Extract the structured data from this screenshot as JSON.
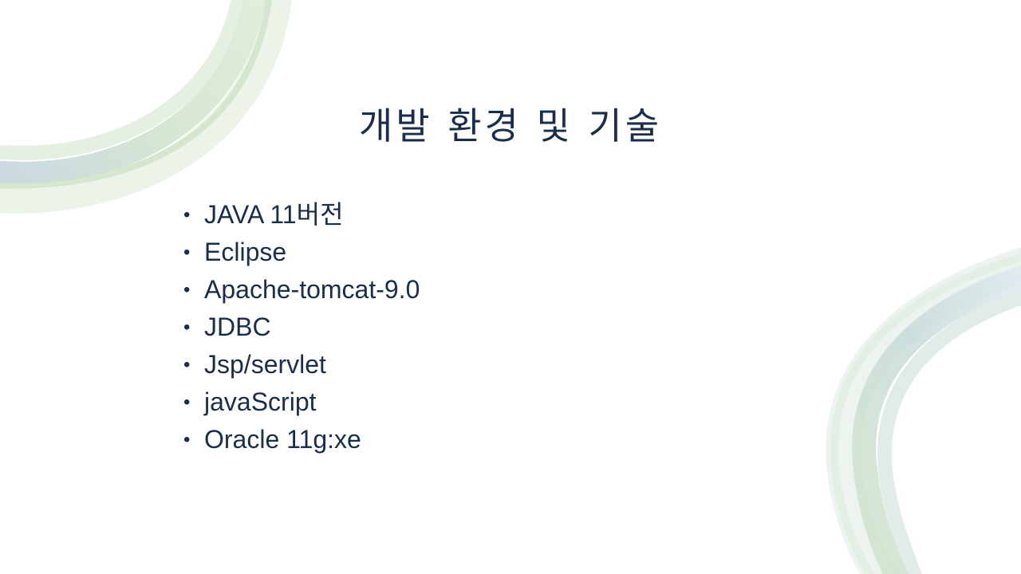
{
  "slide": {
    "title": "개발 환경 및 기술",
    "bullet_glyph": "•",
    "items": [
      "JAVA 11버전",
      "Eclipse",
      "Apache-tomcat-9.0",
      "JDBC",
      "Jsp/servlet",
      "javaScript",
      "Oracle 11g:xe"
    ]
  },
  "colors": {
    "text": "#1a2e4a",
    "accent_green": "#bcd9b0",
    "accent_blue": "#b9d0dc",
    "background": "#ffffff"
  }
}
